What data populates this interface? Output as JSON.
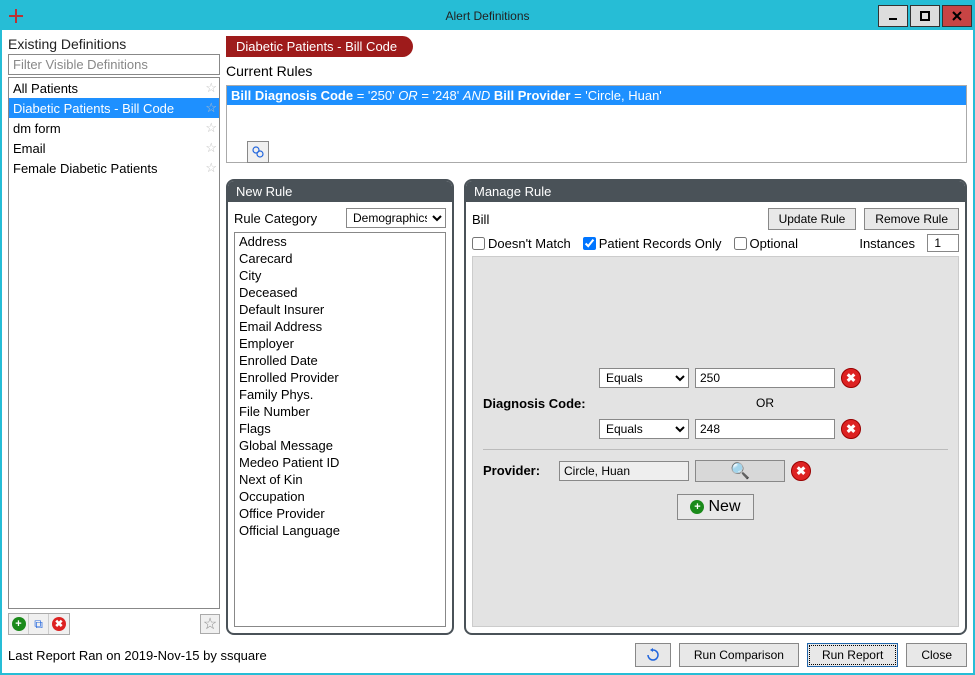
{
  "window": {
    "title": "Alert Definitions",
    "minimize": "—",
    "maximize": "▫",
    "close": "✕"
  },
  "sidebar": {
    "title": "Existing Definitions",
    "filter_placeholder": "Filter Visible Definitions",
    "items": [
      {
        "label": "All Patients",
        "selected": false
      },
      {
        "label": "Diabetic Patients - Bill Code",
        "selected": true
      },
      {
        "label": "dm form",
        "selected": false
      },
      {
        "label": "Email",
        "selected": false
      },
      {
        "label": "Female Diabetic Patients",
        "selected": false
      }
    ]
  },
  "main": {
    "ribbon_title": "Diabetic Patients - Bill Code",
    "current_rules_label": "Current Rules",
    "current_rule": {
      "field1": "Bill Diagnosis Code",
      "val1": "'250'",
      "op1": "OR",
      "val2": "'248'",
      "op2": "AND",
      "field2": "Bill Provider",
      "val3": "'Circle, Huan'",
      "eq": " = "
    }
  },
  "new_rule": {
    "panel_title": "New Rule",
    "category_label": "Rule Category",
    "category_value": "Demographics",
    "fields": [
      "Address",
      "Carecard",
      "City",
      "Deceased",
      "Default Insurer",
      "Email Address",
      "Employer",
      "Enrolled Date",
      "Enrolled Provider",
      "Family Phys.",
      "File Number",
      "Flags",
      "Global Message",
      "Medeo Patient ID",
      "Next of Kin",
      "Occupation",
      "Office Provider",
      "Official Language"
    ]
  },
  "manage_rule": {
    "panel_title": "Manage Rule",
    "subject": "Bill",
    "update_btn": "Update Rule",
    "remove_btn": "Remove Rule",
    "doesnt_match": "Doesn't Match",
    "patient_records_only": "Patient Records Only",
    "optional": "Optional",
    "instances_label": "Instances",
    "instances_value": "1",
    "diagnosis_label": "Diagnosis Code:",
    "provider_label": "Provider:",
    "op_equals": "Equals",
    "or_label": "OR",
    "diag_val1": "250",
    "diag_val2": "248",
    "provider_value": "Circle, Huan",
    "new_btn": "New"
  },
  "footer": {
    "status": "Last Report Ran on 2019-Nov-15 by ssquare",
    "run_comparison": "Run Comparison",
    "run_report": "Run Report",
    "close": "Close"
  },
  "icons": {
    "star": "☆",
    "add": "+",
    "copy": "⧉",
    "delete": "✖",
    "gear": "⚙",
    "search": "🔍",
    "refresh": "↻",
    "x": "✖"
  }
}
